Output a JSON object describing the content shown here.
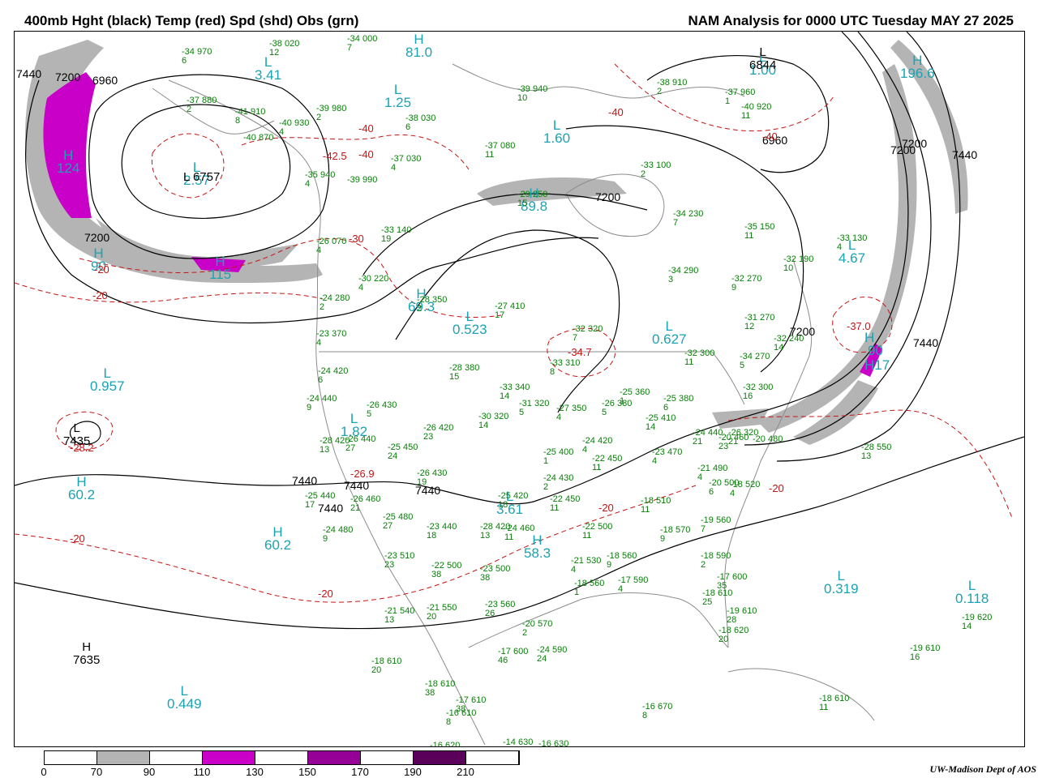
{
  "header": {
    "left_title": "400mb Hght (black) Temp (red) Spd (shd) Obs (grn)",
    "right_title": "NAM Analysis for 0000 UTC Tuesday  MAY 27 2025"
  },
  "colors": {
    "height_contour": "#000000",
    "temp_contour": "#c81414",
    "obs": "#0a7d0a",
    "hl_labels": "#19a3b3",
    "coastline": "#8c8c8c",
    "speed_70_90": "#b4b4b4",
    "speed_110_130": "#c800c8",
    "speed_150_170": "#960096",
    "speed_190_210": "#5a005a"
  },
  "colorbar": {
    "ticks": [
      "0",
      "70",
      "90",
      "110",
      "130",
      "150",
      "170",
      "190",
      "210"
    ],
    "segments": [
      "#ffffff",
      "#b4b4b4",
      "#ffffff",
      "#c800c8",
      "#ffffff",
      "#960096",
      "#ffffff",
      "#5a005a",
      "#ffffff"
    ]
  },
  "credit": "UW-Madison  Dept of AOS",
  "highs_lows": [
    {
      "letter": "H",
      "value": "124"
    },
    {
      "letter": "L",
      "value": "2.57"
    },
    {
      "letter": "L",
      "value": "3.41"
    },
    {
      "letter": "H",
      "value": "81.0"
    },
    {
      "letter": "L",
      "value": "1.25"
    },
    {
      "letter": "L",
      "value": "1.60"
    },
    {
      "letter": "H",
      "value": "89.8"
    },
    {
      "letter": "H",
      "value": "115"
    },
    {
      "letter": "H",
      "value": "90"
    },
    {
      "letter": "H",
      "value": "69.3"
    },
    {
      "letter": "L",
      "value": "0.523"
    },
    {
      "letter": "L",
      "value": "0.627"
    },
    {
      "letter": "L",
      "value": "0.957"
    },
    {
      "letter": "L",
      "value": "1.82"
    },
    {
      "letter": "H",
      "value": "60.2"
    },
    {
      "letter": "H",
      "value": "60.2"
    },
    {
      "letter": "L",
      "value": "3.61"
    },
    {
      "letter": "H",
      "value": "58.3"
    },
    {
      "letter": "L",
      "value": "0.319"
    },
    {
      "letter": "L",
      "value": "0.118"
    },
    {
      "letter": "L",
      "value": "0.449"
    },
    {
      "letter": "L",
      "value": "1.00"
    },
    {
      "letter": "H",
      "value": "196.6"
    },
    {
      "letter": "L",
      "value": "4.67"
    },
    {
      "letter": "H",
      "value": "90"
    },
    {
      "letter": "H",
      "value": "17"
    }
  ],
  "height_extrema": [
    {
      "letter": "L",
      "value": "6757"
    },
    {
      "letter": "L",
      "value": "7435"
    },
    {
      "letter": "H",
      "value": "7635"
    },
    {
      "letter": "L",
      "value": "6844"
    }
  ],
  "height_labels": [
    "7440",
    "7200",
    "6960",
    "7200",
    "6960",
    "7200",
    "7200",
    "7440",
    "7200",
    "7440",
    "7440",
    "7440",
    "7440",
    "7440",
    "7200"
  ],
  "temp_labels": [
    "-40",
    "-42.5",
    "-40",
    "-30",
    "-20",
    "-20",
    "-40",
    "-40",
    "-34.7",
    "-37.0",
    "-28.2",
    "-26.9",
    "-20",
    "-20",
    "-20",
    "-20"
  ],
  "observations": [
    {
      "temp": "-34",
      "height": "970",
      "dew": "6"
    },
    {
      "temp": "-38",
      "height": "020",
      "dew": "12"
    },
    {
      "temp": "-34",
      "height": "000",
      "dew": "7"
    },
    {
      "temp": "-37",
      "height": "880",
      "dew": "2"
    },
    {
      "temp": "-41",
      "height": "910",
      "dew": "8"
    },
    {
      "temp": "-40",
      "height": "930",
      "dew": "4"
    },
    {
      "temp": "-40",
      "height": "870",
      "dew": ""
    },
    {
      "temp": "-39",
      "height": "980",
      "dew": "2"
    },
    {
      "temp": "-38",
      "height": "030",
      "dew": "6"
    },
    {
      "temp": "-37",
      "height": "030",
      "dew": "4"
    },
    {
      "temp": "-39",
      "height": "940",
      "dew": "10"
    },
    {
      "temp": "-37",
      "height": "080",
      "dew": "11"
    },
    {
      "temp": "-38",
      "height": "910",
      "dew": "2"
    },
    {
      "temp": "-37",
      "height": "960",
      "dew": "1"
    },
    {
      "temp": "-40",
      "height": "920",
      "dew": "11"
    },
    {
      "temp": "-35",
      "height": "940",
      "dew": "4"
    },
    {
      "temp": "-39",
      "height": "990",
      "dew": ""
    },
    {
      "temp": "-33",
      "height": "100",
      "dew": "2"
    },
    {
      "temp": "-29",
      "height": "250",
      "dew": "15"
    },
    {
      "temp": "-33",
      "height": "140",
      "dew": "19"
    },
    {
      "temp": "-26",
      "height": "070",
      "dew": "4"
    },
    {
      "temp": "-30",
      "height": "220",
      "dew": "4"
    },
    {
      "temp": "-34",
      "height": "230",
      "dew": "7"
    },
    {
      "temp": "-35",
      "height": "150",
      "dew": "11"
    },
    {
      "temp": "-33",
      "height": "130",
      "dew": "4"
    },
    {
      "temp": "-32",
      "height": "190",
      "dew": "10"
    },
    {
      "temp": "-34",
      "height": "290",
      "dew": "3"
    },
    {
      "temp": "-32",
      "height": "270",
      "dew": "9"
    },
    {
      "temp": "-24",
      "height": "280",
      "dew": "2"
    },
    {
      "temp": "-28",
      "height": "350",
      "dew": "2"
    },
    {
      "temp": "-27",
      "height": "410",
      "dew": "17"
    },
    {
      "temp": "-31",
      "height": "270",
      "dew": "12"
    },
    {
      "temp": "-32",
      "height": "240",
      "dew": "14"
    },
    {
      "temp": "-32",
      "height": "320",
      "dew": "7"
    },
    {
      "temp": "-23",
      "height": "370",
      "dew": "4"
    },
    {
      "temp": "-32",
      "height": "300",
      "dew": "11"
    },
    {
      "temp": "-34",
      "height": "270",
      "dew": "5"
    },
    {
      "temp": "-33",
      "height": "310",
      "dew": "8"
    },
    {
      "temp": "-24",
      "height": "420",
      "dew": "6"
    },
    {
      "temp": "-28",
      "height": "380",
      "dew": "15"
    },
    {
      "temp": "-33",
      "height": "340",
      "dew": "14"
    },
    {
      "temp": "-31",
      "height": "320",
      "dew": "5"
    },
    {
      "temp": "-32",
      "height": "300",
      "dew": "16"
    },
    {
      "temp": "-24",
      "height": "440",
      "dew": "9"
    },
    {
      "temp": "-26",
      "height": "430",
      "dew": "5"
    },
    {
      "temp": "-30",
      "height": "320",
      "dew": "14"
    },
    {
      "temp": "-27",
      "height": "350",
      "dew": "4"
    },
    {
      "temp": "-26",
      "height": "380",
      "dew": "5"
    },
    {
      "temp": "-25",
      "height": "410",
      "dew": "14"
    },
    {
      "temp": "-25",
      "height": "360",
      "dew": "1"
    },
    {
      "temp": "-25",
      "height": "380",
      "dew": "6"
    },
    {
      "temp": "-26",
      "height": "320",
      "dew": "21"
    },
    {
      "temp": "-28",
      "height": "420",
      "dew": "13"
    },
    {
      "temp": "-26",
      "height": "440",
      "dew": "27"
    },
    {
      "temp": "-26",
      "height": "420",
      "dew": "23"
    },
    {
      "temp": "-25",
      "height": "450",
      "dew": "24"
    },
    {
      "temp": "-24",
      "height": "420",
      "dew": "4"
    },
    {
      "temp": "-24",
      "height": "440",
      "dew": "21"
    },
    {
      "temp": "-20",
      "height": "460",
      "dew": "23"
    },
    {
      "temp": "-20",
      "height": "480",
      "dew": ""
    },
    {
      "temp": "-25",
      "height": "400",
      "dew": "1"
    },
    {
      "temp": "-22",
      "height": "450",
      "dew": "11"
    },
    {
      "temp": "-23",
      "height": "470",
      "dew": "4"
    },
    {
      "temp": "-28",
      "height": "550",
      "dew": "13"
    },
    {
      "temp": "-26",
      "height": "430",
      "dew": "19"
    },
    {
      "temp": "-25",
      "height": "440",
      "dew": "17"
    },
    {
      "temp": "-26",
      "height": "460",
      "dew": "21"
    },
    {
      "temp": "-24",
      "height": "430",
      "dew": "2"
    },
    {
      "temp": "-25",
      "height": "420",
      "dew": "18"
    },
    {
      "temp": "-22",
      "height": "450",
      "dew": "11"
    },
    {
      "temp": "-21",
      "height": "490",
      "dew": "4"
    },
    {
      "temp": "-20",
      "height": "500",
      "dew": "6"
    },
    {
      "temp": "-18",
      "height": "520",
      "dew": "4"
    },
    {
      "temp": "-18",
      "height": "510",
      "dew": "11"
    },
    {
      "temp": "-24",
      "height": "480",
      "dew": "9"
    },
    {
      "temp": "-25",
      "height": "480",
      "dew": "27"
    },
    {
      "temp": "-23",
      "height": "440",
      "dew": "18"
    },
    {
      "temp": "-28",
      "height": "420",
      "dew": "13"
    },
    {
      "temp": "-24",
      "height": "460",
      "dew": "11"
    },
    {
      "temp": "-22",
      "height": "500",
      "dew": "11"
    },
    {
      "temp": "-18",
      "height": "570",
      "dew": "9"
    },
    {
      "temp": "-19",
      "height": "560",
      "dew": "7"
    },
    {
      "temp": "-23",
      "height": "510",
      "dew": "23"
    },
    {
      "temp": "-22",
      "height": "500",
      "dew": "38"
    },
    {
      "temp": "-23",
      "height": "500",
      "dew": "38"
    },
    {
      "temp": "-21",
      "height": "530",
      "dew": "4"
    },
    {
      "temp": "-18",
      "height": "560",
      "dew": "9"
    },
    {
      "temp": "-18",
      "height": "590",
      "dew": "2"
    },
    {
      "temp": "-17",
      "height": "600",
      "dew": "35"
    },
    {
      "temp": "-18",
      "height": "610",
      "dew": "25"
    },
    {
      "temp": "-21",
      "height": "540",
      "dew": "13"
    },
    {
      "temp": "-21",
      "height": "550",
      "dew": "20"
    },
    {
      "temp": "-23",
      "height": "560",
      "dew": "26"
    },
    {
      "temp": "-18",
      "height": "560",
      "dew": "1"
    },
    {
      "temp": "-17",
      "height": "590",
      "dew": "4"
    },
    {
      "temp": "-19",
      "height": "610",
      "dew": "28"
    },
    {
      "temp": "-18",
      "height": "620",
      "dew": "20"
    },
    {
      "temp": "-20",
      "height": "570",
      "dew": "2"
    },
    {
      "temp": "-17",
      "height": "600",
      "dew": "46"
    },
    {
      "temp": "-24",
      "height": "590",
      "dew": "24"
    },
    {
      "temp": "-18",
      "height": "610",
      "dew": "20"
    },
    {
      "temp": "-18",
      "height": "610",
      "dew": "38"
    },
    {
      "temp": "-17",
      "height": "610",
      "dew": "38"
    },
    {
      "temp": "-16",
      "height": "610",
      "dew": "8"
    },
    {
      "temp": "-16",
      "height": "620",
      "dew": ""
    },
    {
      "temp": "-14",
      "height": "630",
      "dew": ""
    },
    {
      "temp": "-16",
      "height": "630",
      "dew": ""
    },
    {
      "temp": "-16",
      "height": "670",
      "dew": "8"
    },
    {
      "temp": "-18",
      "height": "610",
      "dew": "11"
    },
    {
      "temp": "-19",
      "height": "620",
      "dew": "14"
    },
    {
      "temp": "-19",
      "height": "610",
      "dew": "16"
    }
  ]
}
